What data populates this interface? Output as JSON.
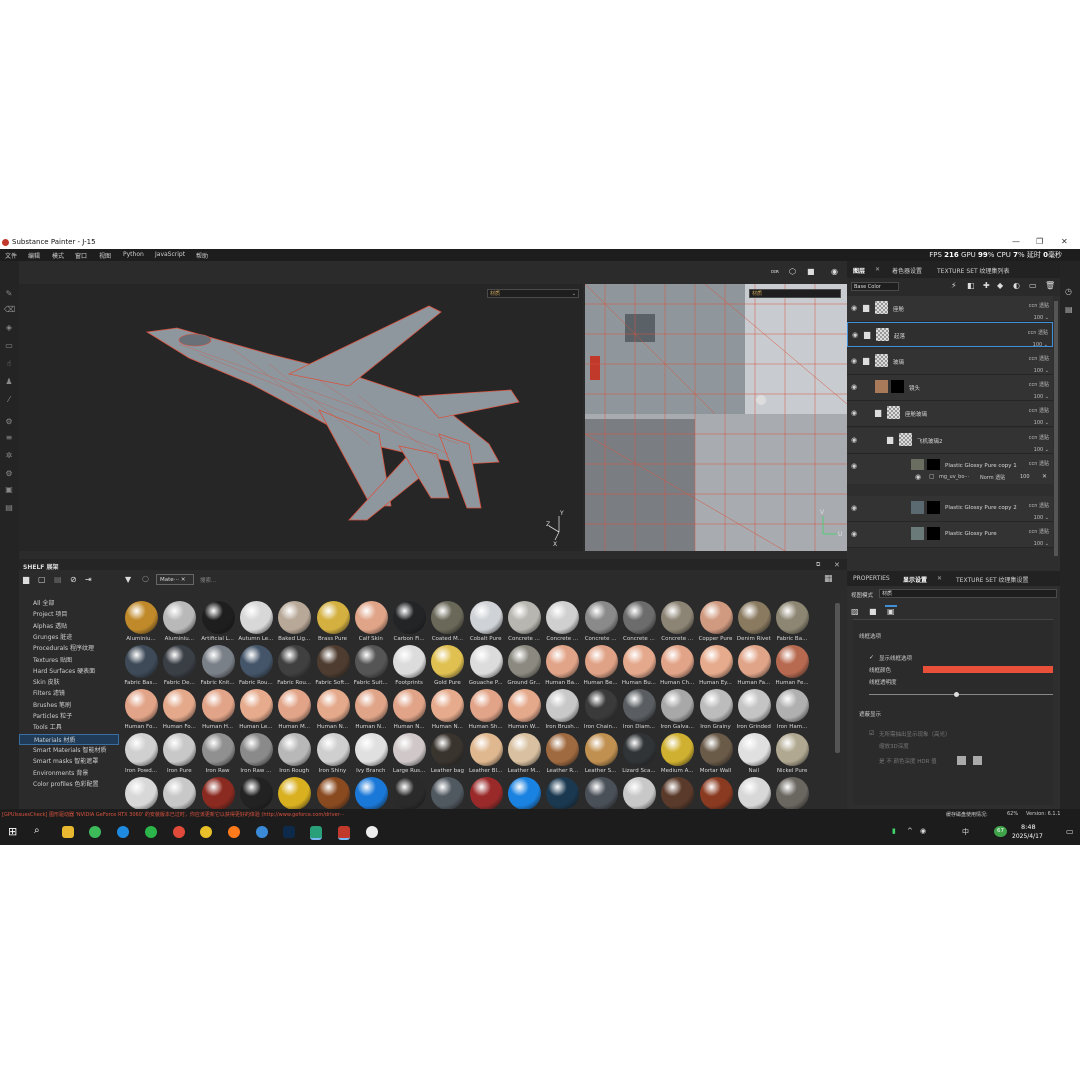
{
  "window": {
    "title": "Substance Painter - J-15",
    "min": "—",
    "max": "❐",
    "close": "✕"
  },
  "menu": [
    "文件",
    "编辑",
    "模式",
    "窗口",
    "视图",
    "Python",
    "JavaScript",
    "帮助"
  ],
  "stats": {
    "fps_label": "FPS",
    "fps": "216",
    "gpu_label": "GPU",
    "gpu": "99",
    "cpu_label": "% CPU",
    "cpu": "7",
    "latency_label": "% 延时",
    "latency": "0",
    "latency_unit": "毫秒"
  },
  "viewport": {
    "mode_3d": "材质",
    "mode_uv": "材质",
    "top_label": "ᴅɪʀ"
  },
  "shelf": {
    "title": "SHELF 展架",
    "search_tag": "Mate⋯",
    "search_placeholder": "搜索...",
    "categories": [
      {
        "label": "All 全部",
        "selected": false
      },
      {
        "label": "Project 项目",
        "selected": false
      },
      {
        "label": "Alphas 透贴",
        "selected": false
      },
      {
        "label": "Grunges 脏迹",
        "selected": false
      },
      {
        "label": "Procedurals 程序纹理",
        "selected": false
      },
      {
        "label": "Textures 贴图",
        "selected": false
      },
      {
        "label": "Hard Surfaces 硬表面",
        "selected": false
      },
      {
        "label": "Skin 皮肤",
        "selected": false
      },
      {
        "label": "Filters 滤镜",
        "selected": false
      },
      {
        "label": "Brushes 笔刷",
        "selected": false
      },
      {
        "label": "Particles 粒子",
        "selected": false
      },
      {
        "label": "Tools 工具",
        "selected": false
      },
      {
        "label": "Materials 材质",
        "selected": true
      },
      {
        "label": "Smart Materials 智能材质",
        "selected": false
      },
      {
        "label": "Smart masks 智能遮罩",
        "selected": false
      },
      {
        "label": "Environments 背景",
        "selected": false
      },
      {
        "label": "Color profiles 色彩配置",
        "selected": false
      }
    ],
    "materials": [
      [
        {
          "n": "Aluminiu...",
          "c": "#c08a2a"
        },
        {
          "n": "Aluminiu...",
          "c": "#b9b9b9"
        },
        {
          "n": "Artificial L...",
          "c": "#1e1e1e"
        },
        {
          "n": "Autumn Le...",
          "c": "#d8d8d8"
        },
        {
          "n": "Baked Lig...",
          "c": "#b8a898"
        },
        {
          "n": "Brass Pure",
          "c": "#d4b040"
        },
        {
          "n": "Calf Skin",
          "c": "#e0a488"
        },
        {
          "n": "Carbon Fi...",
          "c": "#222426"
        },
        {
          "n": "Coated M...",
          "c": "#6a6858"
        },
        {
          "n": "Cobalt Pure",
          "c": "#cfd2d6"
        },
        {
          "n": "Concrete ...",
          "c": "#b8b6b0"
        },
        {
          "n": "Concrete ...",
          "c": "#d0d0d0"
        },
        {
          "n": "Concrete ...",
          "c": "#8a8a8a"
        },
        {
          "n": "Concrete ...",
          "c": "#6c6c6c"
        },
        {
          "n": "Concrete ...",
          "c": "#8c8474"
        },
        {
          "n": "Copper Pure",
          "c": "#d09a80"
        },
        {
          "n": "Denim Rivet",
          "c": "#8a7a60"
        },
        {
          "n": "Fabric Ba...",
          "c": "#8c8672"
        }
      ],
      [
        {
          "n": "Fabric Bas...",
          "c": "#3e4a58"
        },
        {
          "n": "Fabric De...",
          "c": "#3a3f46"
        },
        {
          "n": "Fabric Knit...",
          "c": "#7a8088"
        },
        {
          "n": "Fabric Rou...",
          "c": "#44556a"
        },
        {
          "n": "Fabric Rou...",
          "c": "#404040"
        },
        {
          "n": "Fabric Soft...",
          "c": "#4e3c30"
        },
        {
          "n": "Fabric Suit...",
          "c": "#555555"
        },
        {
          "n": "Footprints",
          "c": "#dcdcdc"
        },
        {
          "n": "Gold Pure",
          "c": "#e0c050"
        },
        {
          "n": "Gouache P...",
          "c": "#dcdcdc"
        },
        {
          "n": "Ground Gr...",
          "c": "#8c8a80"
        },
        {
          "n": "Human Ba...",
          "c": "#e2a488"
        },
        {
          "n": "Human Be...",
          "c": "#e0a286"
        },
        {
          "n": "Human Bu...",
          "c": "#e4a88c"
        },
        {
          "n": "Human Ch...",
          "c": "#e2a488"
        },
        {
          "n": "Human Ey...",
          "c": "#e6aa8c"
        },
        {
          "n": "Human Fa...",
          "c": "#e0a488"
        },
        {
          "n": "Human Fe...",
          "c": "#b86a50"
        }
      ],
      [
        {
          "n": "Human Fo...",
          "c": "#e2a488"
        },
        {
          "n": "Human Fo...",
          "c": "#e4a88a"
        },
        {
          "n": "Human H...",
          "c": "#e2a488"
        },
        {
          "n": "Human Le...",
          "c": "#e6aa8c"
        },
        {
          "n": "Human M...",
          "c": "#e2a488"
        },
        {
          "n": "Human N...",
          "c": "#e4a88a"
        },
        {
          "n": "Human N...",
          "c": "#e0a488"
        },
        {
          "n": "Human N...",
          "c": "#e2a488"
        },
        {
          "n": "Human N...",
          "c": "#e6aa8c"
        },
        {
          "n": "Human Sh...",
          "c": "#e2a488"
        },
        {
          "n": "Human W...",
          "c": "#e4a88a"
        },
        {
          "n": "Iron Brush...",
          "c": "#c8c8c8"
        },
        {
          "n": "Iron Chain...",
          "c": "#3a3a3a"
        },
        {
          "n": "Iron Diam...",
          "c": "#5a5e62"
        },
        {
          "n": "Iron Galva...",
          "c": "#a8a8a8"
        },
        {
          "n": "Iron Grainy",
          "c": "#bcbcbc"
        },
        {
          "n": "Iron Grinded",
          "c": "#c4c4c4"
        },
        {
          "n": "Iron Ham...",
          "c": "#b0b0b0"
        }
      ],
      [
        {
          "n": "Iron Powd...",
          "c": "#d0d0d0"
        },
        {
          "n": "Iron Pure",
          "c": "#c8c8c8"
        },
        {
          "n": "Iron Raw",
          "c": "#909090"
        },
        {
          "n": "Iron Raw ...",
          "c": "#8a8a8a"
        },
        {
          "n": "Iron Rough",
          "c": "#b8b8b8"
        },
        {
          "n": "Iron Shiny",
          "c": "#cfcfcf"
        },
        {
          "n": "Ivy Branch",
          "c": "#e0e0e0"
        },
        {
          "n": "Large Rus...",
          "c": "#d0c8c8"
        },
        {
          "n": "Leather bag",
          "c": "#3a342e"
        },
        {
          "n": "Leather Bl...",
          "c": "#e0b890"
        },
        {
          "n": "Leather M...",
          "c": "#d8c0a0"
        },
        {
          "n": "Leather R...",
          "c": "#a06a40"
        },
        {
          "n": "Leather S...",
          "c": "#c09050"
        },
        {
          "n": "Lizard Sca...",
          "c": "#303436"
        },
        {
          "n": "Medium A...",
          "c": "#d0b030"
        },
        {
          "n": "Mortar Wall",
          "c": "#6a5a48"
        },
        {
          "n": "Nail",
          "c": "#e0e0e0"
        },
        {
          "n": "Nickel Pure",
          "c": "#b0a890"
        }
      ],
      [
        {
          "n": "",
          "c": "#d8d8d8"
        },
        {
          "n": "",
          "c": "#c8c8c8"
        },
        {
          "n": "",
          "c": "#8a2a20"
        },
        {
          "n": "",
          "c": "#222222"
        },
        {
          "n": "",
          "c": "#d8b020"
        },
        {
          "n": "",
          "c": "#8a4a20"
        },
        {
          "n": "",
          "c": "#1a78d8"
        },
        {
          "n": "",
          "c": "#2a2a2a"
        },
        {
          "n": "",
          "c": "#505860"
        },
        {
          "n": "",
          "c": "#9a2a2a"
        },
        {
          "n": "",
          "c": "#1a82e0"
        },
        {
          "n": "",
          "c": "#1a3850"
        },
        {
          "n": "",
          "c": "#4a5058"
        },
        {
          "n": "",
          "c": "#c8c8c8"
        },
        {
          "n": "",
          "c": "#5a3a2a"
        },
        {
          "n": "",
          "c": "#8a3a20"
        },
        {
          "n": "",
          "c": "#d8d8d8"
        },
        {
          "n": "",
          "c": "#6a6660"
        }
      ]
    ]
  },
  "layers_panel": {
    "tabs": [
      "图层",
      "着色器设置",
      "TEXTURE SET 纹理集列表"
    ],
    "channel": "Base Color",
    "layers": [
      {
        "name": "座舱",
        "blend": "ccn 透贴",
        "opacity": "100",
        "indent": 0,
        "type": "folder"
      },
      {
        "name": "起落",
        "blend": "ccn 透贴",
        "opacity": "100",
        "indent": 0,
        "type": "folder",
        "selected": true
      },
      {
        "name": "玻璃",
        "blend": "ccn 透贴",
        "opacity": "100",
        "indent": 0,
        "type": "folder"
      },
      {
        "name": "镜头",
        "blend": "ccn 透贴",
        "opacity": "100",
        "indent": 0,
        "type": "fill"
      },
      {
        "name": "座舱玻璃",
        "blend": "ccn 透贴",
        "opacity": "100",
        "indent": 1,
        "type": "folder"
      },
      {
        "name": "飞机玻璃2",
        "blend": "ccn 透贴",
        "opacity": "100",
        "indent": 2,
        "type": "folder"
      },
      {
        "name": "Plastic Glossy Pure copy 1",
        "blend": "ccn 透贴",
        "opacity": "100",
        "indent": 3,
        "type": "fill"
      },
      {
        "name": "Plastic Glossy Pure copy 2",
        "blend": "ccn 透贴",
        "opacity": "100",
        "indent": 3,
        "type": "fill"
      },
      {
        "name": "Plastic Glossy Pure",
        "blend": "ccn 透贴",
        "opacity": "100",
        "indent": 3,
        "type": "fill"
      }
    ],
    "sub_mask": {
      "name": "mg_uv_bo⋯",
      "blend": "Norm 透贴",
      "opacity": "100"
    }
  },
  "props_panel": {
    "tabs": [
      "PROPERTIES",
      "显示设置",
      "TEXTURE SET 纹理集设置"
    ],
    "view_mode_label": "视图模式",
    "view_mode_value": "材质",
    "wire_title": "线框选项",
    "wire_show": "显示线框选项",
    "wire_color": "线框颜色",
    "wire_opacity": "线框透明度",
    "wire_color_hex": "#e8503a",
    "occl_title": "遮蔽显示",
    "occl_show": "无所需抽出显示现象（高光）",
    "occl_scale": "缩放3D深度",
    "occl_alpha": "是 不 颜色深度 HDR 值"
  },
  "status": {
    "left": "[GPUIssuesCheck] 图形驱动器 'NVIDIA GeForce RTX 3060' 的安装版本已过时，你应该更新它以获得更好的体验 (http://www.geforce.com/driver⋯",
    "cache_label": "缓存磁盘使用情况:",
    "cache": "62%",
    "version": "Version: 6.1.1"
  },
  "taskbar": {
    "time": "8:48",
    "date": "2025/4/17",
    "badge": "67",
    "ime": "中"
  }
}
